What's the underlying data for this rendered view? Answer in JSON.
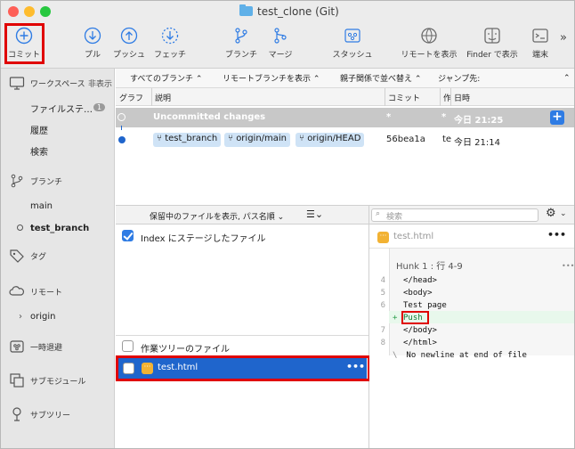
{
  "window": {
    "title": "test_clone (Git)"
  },
  "toolbar": {
    "commit": "コミット",
    "pull": "プル",
    "push": "プッシュ",
    "fetch": "フェッチ",
    "branch": "ブランチ",
    "merge": "マージ",
    "stash": "スタッシュ",
    "show_remote": "リモートを表示",
    "show_finder": "Finder で表示",
    "terminal": "端末",
    "overflow": "»"
  },
  "sidebar": {
    "workspace": "ワークスペース",
    "hide": "非表示",
    "file_status": "ファイルステ…",
    "file_status_count": "1",
    "history": "履歴",
    "search": "検索",
    "branches": "ブランチ",
    "branch_main": "main",
    "branch_current": "test_branch",
    "tags": "タグ",
    "remotes": "リモート",
    "remote_origin": "origin",
    "stashes": "一時退避",
    "submodules": "サブモジュール",
    "subtrees": "サブツリー"
  },
  "filters": {
    "all_branches": "すべてのブランチ",
    "show_remote_branches": "リモートブランチを表示",
    "parent_order": "親子関係で並べ替え",
    "jump_to": "ジャンプ先:"
  },
  "columns": {
    "graph": "グラフ",
    "description": "説明",
    "commit": "コミット",
    "author": "作",
    "date": "日時"
  },
  "commits": [
    {
      "description": "Uncommitted changes",
      "commit": "*",
      "author": "*",
      "date": "今日 21:25"
    },
    {
      "tags": [
        "test_branch",
        "origin/main",
        "origin/HEAD"
      ],
      "commit": "56bea1a",
      "author": "te",
      "date": "今日 21:14"
    }
  ],
  "lower": {
    "view_mode": "保留中のファイルを表示, パス名順",
    "search_placeholder": "検索",
    "staged_header": "Index にステージしたファイル",
    "unstaged_header": "作業ツリーのファイル",
    "selected_file": "test.html",
    "more": "•••"
  },
  "diff": {
    "file": "test.html",
    "hunk": "Hunk 1 : 行 4-9",
    "lines": [
      {
        "old": "4",
        "new": "",
        "sign": "",
        "text": "</head>"
      },
      {
        "old": "5",
        "new": "",
        "sign": "",
        "text": "<body>"
      },
      {
        "old": "6",
        "new": "",
        "sign": "",
        "text": "Test page"
      },
      {
        "old": "",
        "new": "",
        "sign": "+",
        "text": "Push"
      },
      {
        "old": "7",
        "new": "",
        "sign": "",
        "text": "</body>"
      },
      {
        "old": "8",
        "new": "",
        "sign": "",
        "text": "</html>"
      },
      {
        "old": "",
        "new": "",
        "sign": "\\",
        "text": " No newline at end of file"
      }
    ]
  },
  "colors": {
    "accent": "#1f65cc",
    "highlight": "#e00000",
    "added_line": "#e8f8ec"
  }
}
